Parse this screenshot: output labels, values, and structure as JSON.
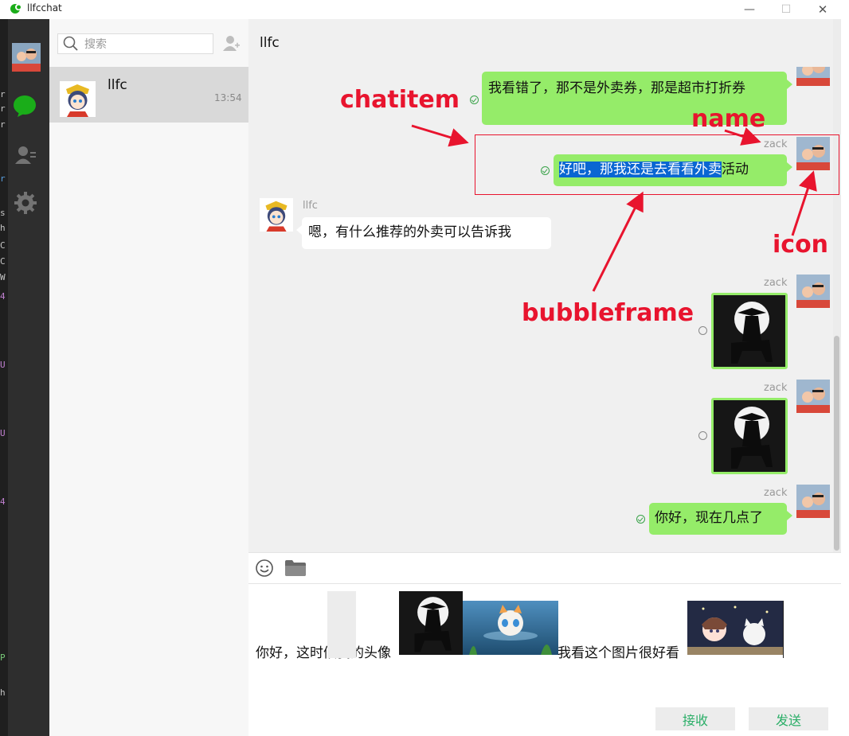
{
  "window": {
    "title": "llfcchat",
    "minimize_glyph": "—",
    "maximize_glyph": "☐",
    "close_glyph": "✕"
  },
  "sidebar": {
    "items": [
      {
        "name": "avatar"
      },
      {
        "name": "chat-icon"
      },
      {
        "name": "contacts-icon"
      },
      {
        "name": "settings-icon"
      }
    ]
  },
  "left_strip_chars": [
    "r",
    "r",
    "r",
    "r",
    "s",
    "h",
    "C",
    "C",
    "W",
    "4",
    "U",
    "U",
    "4",
    "P",
    "h"
  ],
  "search": {
    "placeholder": "搜索"
  },
  "chat_list": [
    {
      "name": "llfc",
      "time": "13:54"
    }
  ],
  "chat": {
    "title": "llfc",
    "messages": [
      {
        "from": "self",
        "text": "我看错了，那不是外卖券，那是超市打折券",
        "status": "sent"
      },
      {
        "from": "self",
        "name": "zack",
        "text_selected": "好吧，那我还是去看看外卖",
        "text_rest": "活动",
        "status": "sent"
      },
      {
        "from": "other",
        "name": "llfc",
        "text": "嗯，有什么推荐的外卖可以告诉我"
      },
      {
        "from": "self",
        "name": "zack",
        "type": "image",
        "status": "pending"
      },
      {
        "from": "self",
        "name": "zack",
        "type": "image",
        "status": "pending"
      },
      {
        "from": "self",
        "name": "zack",
        "text": "你好，现在几点了",
        "status": "sent"
      }
    ]
  },
  "toolbar": {
    "emoji": "emoji-icon",
    "file": "folder-icon"
  },
  "input": {
    "text_part1": "你好，这时候我的头像",
    "text_part2": "我看这个图片很好看"
  },
  "buttons": {
    "receive": "接收",
    "send": "发送"
  },
  "annotations": {
    "chatitem": "chatitem",
    "name": "name",
    "bubbleframe": "bubbleframe",
    "icon": "icon"
  },
  "colors": {
    "bubble_self": "#95ec69",
    "bubble_other": "#ffffff",
    "annotation": "#e8142e",
    "button_text": "#2aae67",
    "nav_active": "#1aad19"
  }
}
